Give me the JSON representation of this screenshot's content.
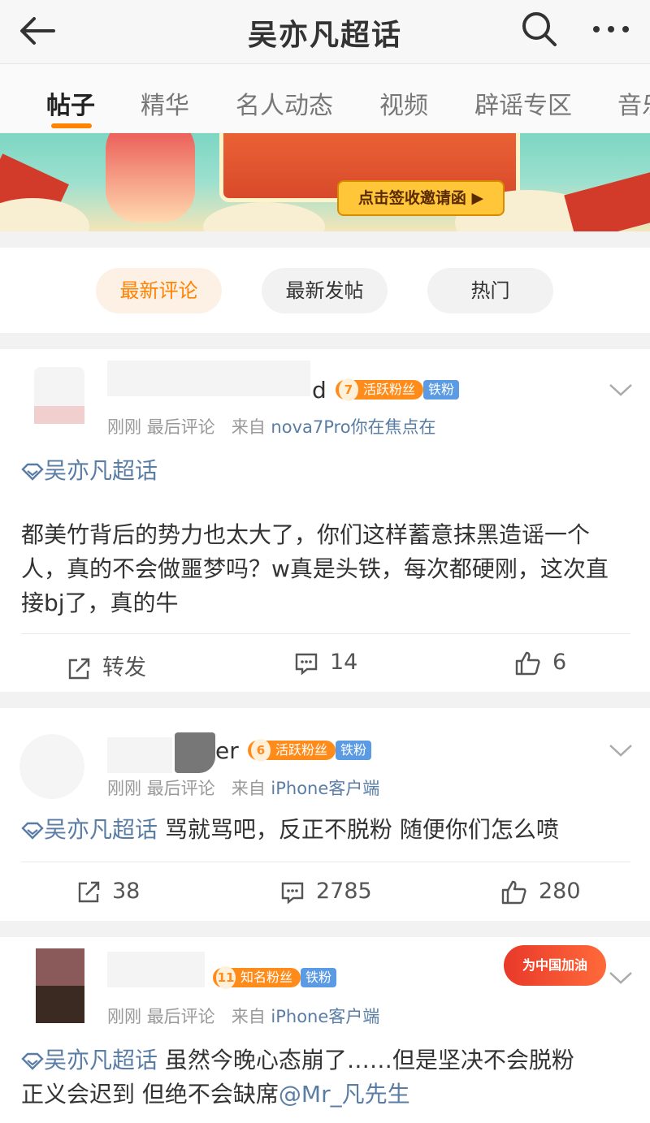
{
  "header": {
    "title": "吴亦凡超话",
    "back_icon": "arrow-left-icon",
    "search_icon": "search-icon",
    "more_icon": "more-dots-icon"
  },
  "tabs": [
    {
      "label": "帖子",
      "active": true
    },
    {
      "label": "精华"
    },
    {
      "label": "名人动态"
    },
    {
      "label": "视频"
    },
    {
      "label": "辟谣专区"
    },
    {
      "label": "音乐"
    }
  ],
  "banner": {
    "cta_label": "点击签收邀请函 ▶"
  },
  "sort": {
    "latest_comment": "最新评论",
    "latest_post": "最新发帖",
    "hot": "热门",
    "active_color": "#ff8200"
  },
  "posts": [
    {
      "name_suffix": "d",
      "level": "7",
      "level_label": "活跃粉丝",
      "iron": "铁粉",
      "time": "刚刚",
      "last_comment": "最后评论",
      "from": "来自",
      "source": "nova7Pro你在焦点在",
      "topic": "吴亦凡超话",
      "text": "都美竹背后的势力也太大了，你们这样蓄意抹黑造谣一个人，真的不会做噩梦吗？w真是头铁，每次都硬刚，这次直接bj了，真的牛",
      "repost": "转发",
      "comments": "14",
      "likes": "6"
    },
    {
      "name_suffix": "er",
      "level": "6",
      "level_label": "活跃粉丝",
      "iron": "铁粉",
      "time": "刚刚",
      "last_comment": "最后评论",
      "from": "来自",
      "source": "iPhone客户端",
      "topic": "吴亦凡超话",
      "text": " 骂就骂吧，反正不脱粉 随便你们怎么喷",
      "repost": "38",
      "comments": "2785",
      "likes": "280"
    },
    {
      "level": "11",
      "level_label": "知名粉丝",
      "iron": "铁粉",
      "sticker": "为中国加油",
      "time": "刚刚",
      "last_comment": "最后评论",
      "from": "来自",
      "source": "iPhone客户端",
      "topic": "吴亦凡超话",
      "text_line1": " 虽然今晚心态崩了……但是坚决不会脱粉",
      "text_line2": "正义会迟到   但绝不会缺席",
      "mention": "@Mr_凡先生"
    }
  ]
}
